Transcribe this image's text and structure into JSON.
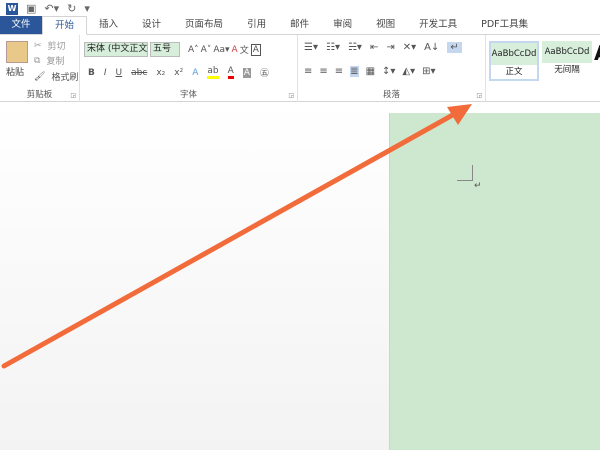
{
  "qat": {
    "icons": [
      "word-logo",
      "save-icon",
      "undo-icon",
      "redo-icon",
      "customize-icon"
    ]
  },
  "tabs": [
    "文件",
    "开始",
    "插入",
    "设计",
    "页面布局",
    "引用",
    "邮件",
    "审阅",
    "视图",
    "开发工具",
    "PDF工具集"
  ],
  "active_tab": "开始",
  "clipboard": {
    "paste": "粘贴",
    "cut": "剪切",
    "copy": "复制",
    "format_painter": "格式刷",
    "label": "剪贴板"
  },
  "font": {
    "name": "宋体 (中文正文",
    "size": "五号",
    "label": "字体",
    "buttons": [
      "B",
      "I",
      "U",
      "abc",
      "x₂",
      "x²"
    ]
  },
  "paragraph": {
    "label": "段落"
  },
  "styles": [
    {
      "sample": "AaBbCcDd",
      "name": "正文"
    },
    {
      "sample": "AaBbCcDd",
      "name": "无间隔"
    }
  ],
  "colors": {
    "accent": "#2b579a",
    "page": "#cde8cf",
    "arrow": "#f26b3a",
    "style_bg": "#d7eedb"
  }
}
